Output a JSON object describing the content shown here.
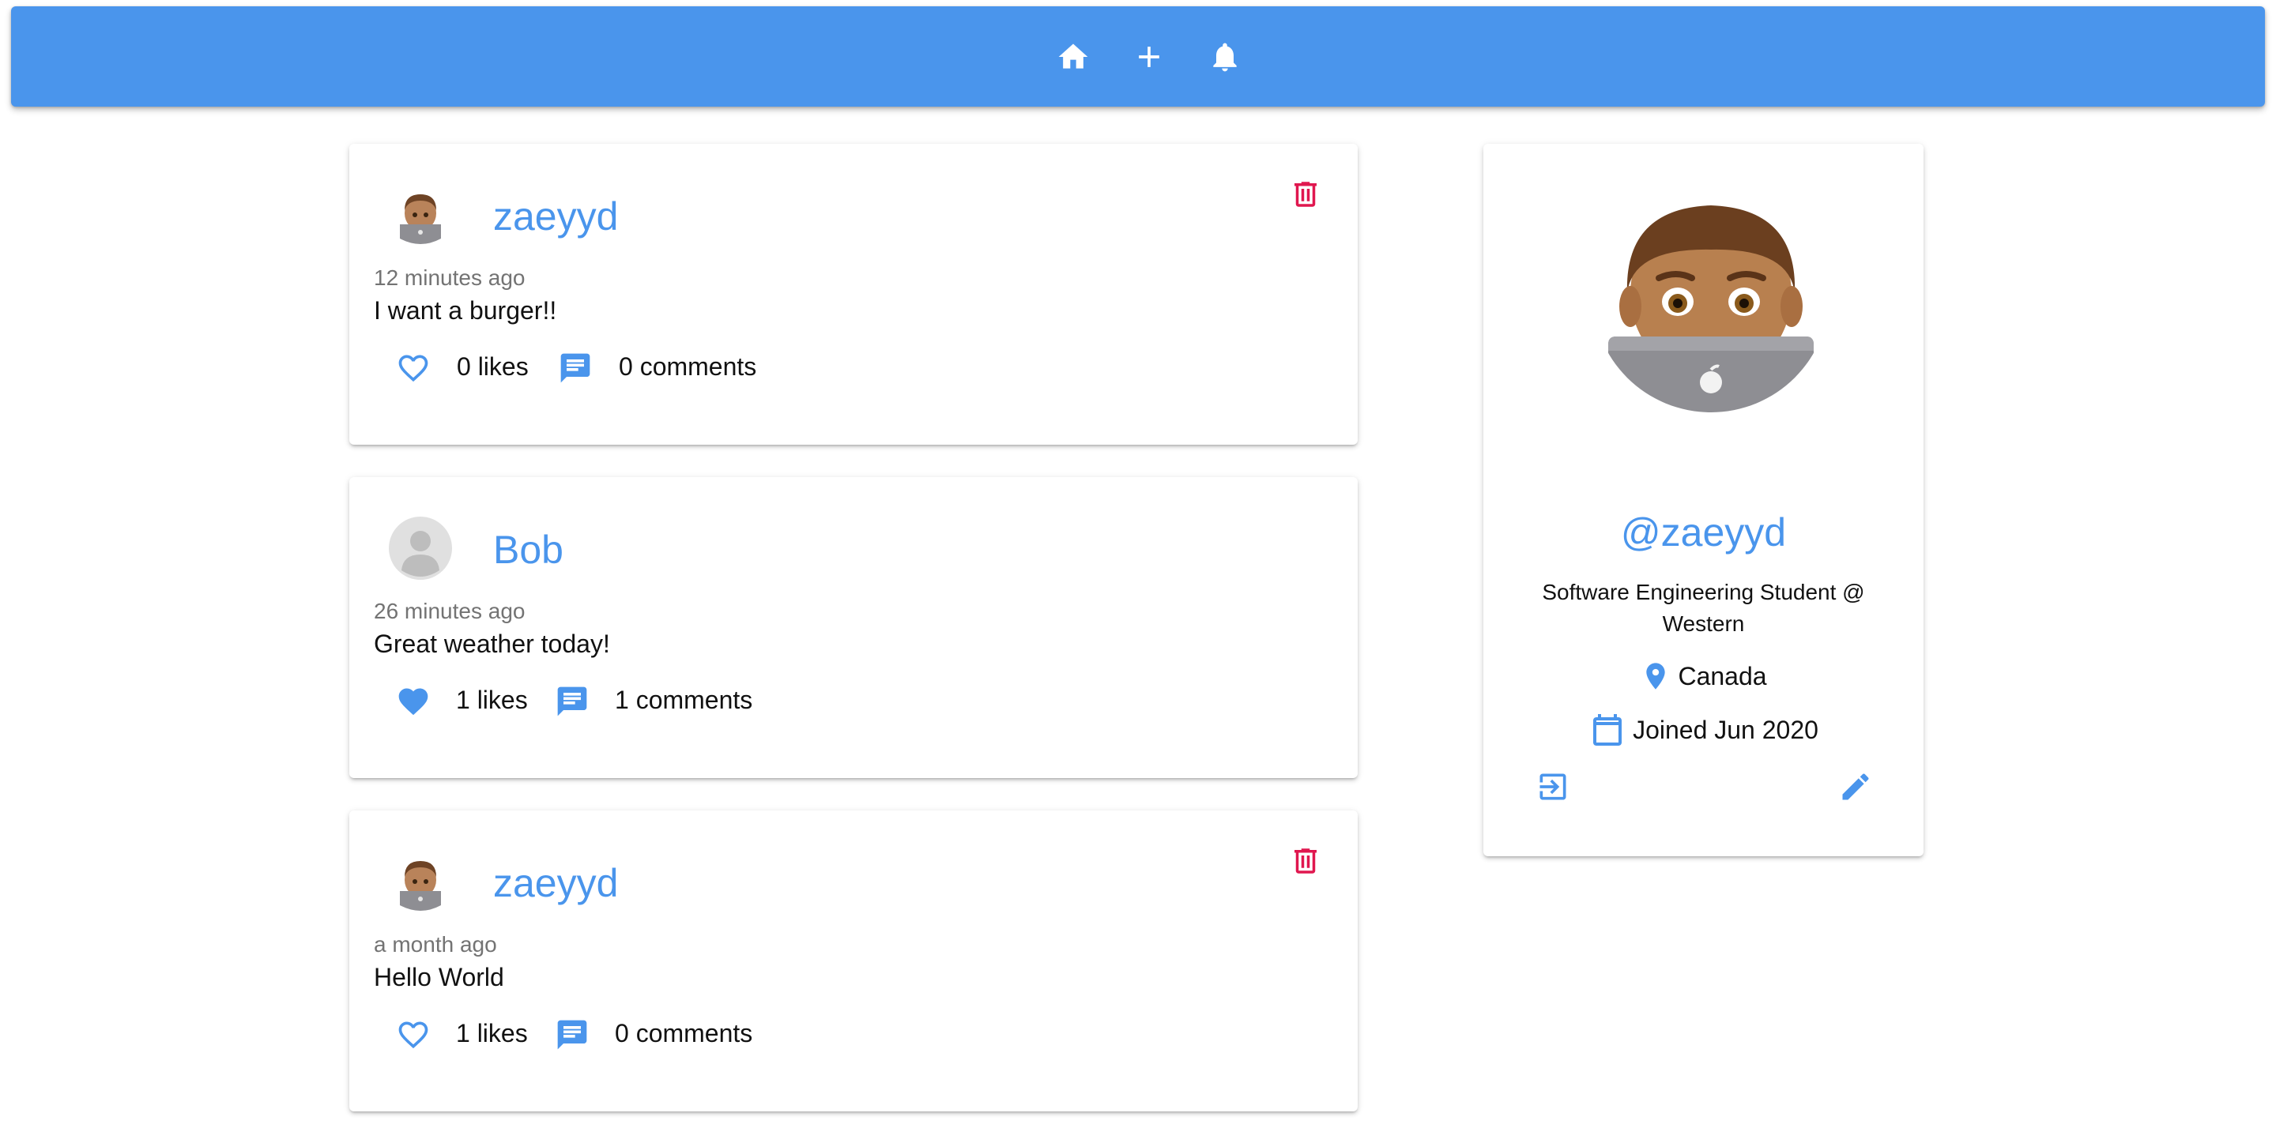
{
  "colors": {
    "primary": "#4a95ec",
    "delete": "#e0174f",
    "muted": "#737373"
  },
  "navbar": {
    "items": [
      {
        "icon": "home-icon"
      },
      {
        "icon": "plus-icon"
      },
      {
        "icon": "bell-icon"
      }
    ]
  },
  "posts": [
    {
      "username": "zaeyyd",
      "avatar": "emoji-avatar",
      "time": "12 minutes ago",
      "body": "I want a burger!!",
      "liked": false,
      "likes_label": "0 likes",
      "comments_label": "0 comments",
      "deletable": true
    },
    {
      "username": "Bob",
      "avatar": "default-avatar",
      "time": "26 minutes ago",
      "body": "Great weather today!",
      "liked": true,
      "likes_label": "1 likes",
      "comments_label": "1 comments",
      "deletable": false
    },
    {
      "username": "zaeyyd",
      "avatar": "emoji-avatar",
      "time": "a month ago",
      "body": "Hello World",
      "liked": false,
      "likes_label": "1 likes",
      "comments_label": "0 comments",
      "deletable": true
    }
  ],
  "profile": {
    "handle": "@zaeyyd",
    "bio": "Software Engineering Student @ Western",
    "location": "Canada",
    "joined": "Joined Jun 2020"
  }
}
